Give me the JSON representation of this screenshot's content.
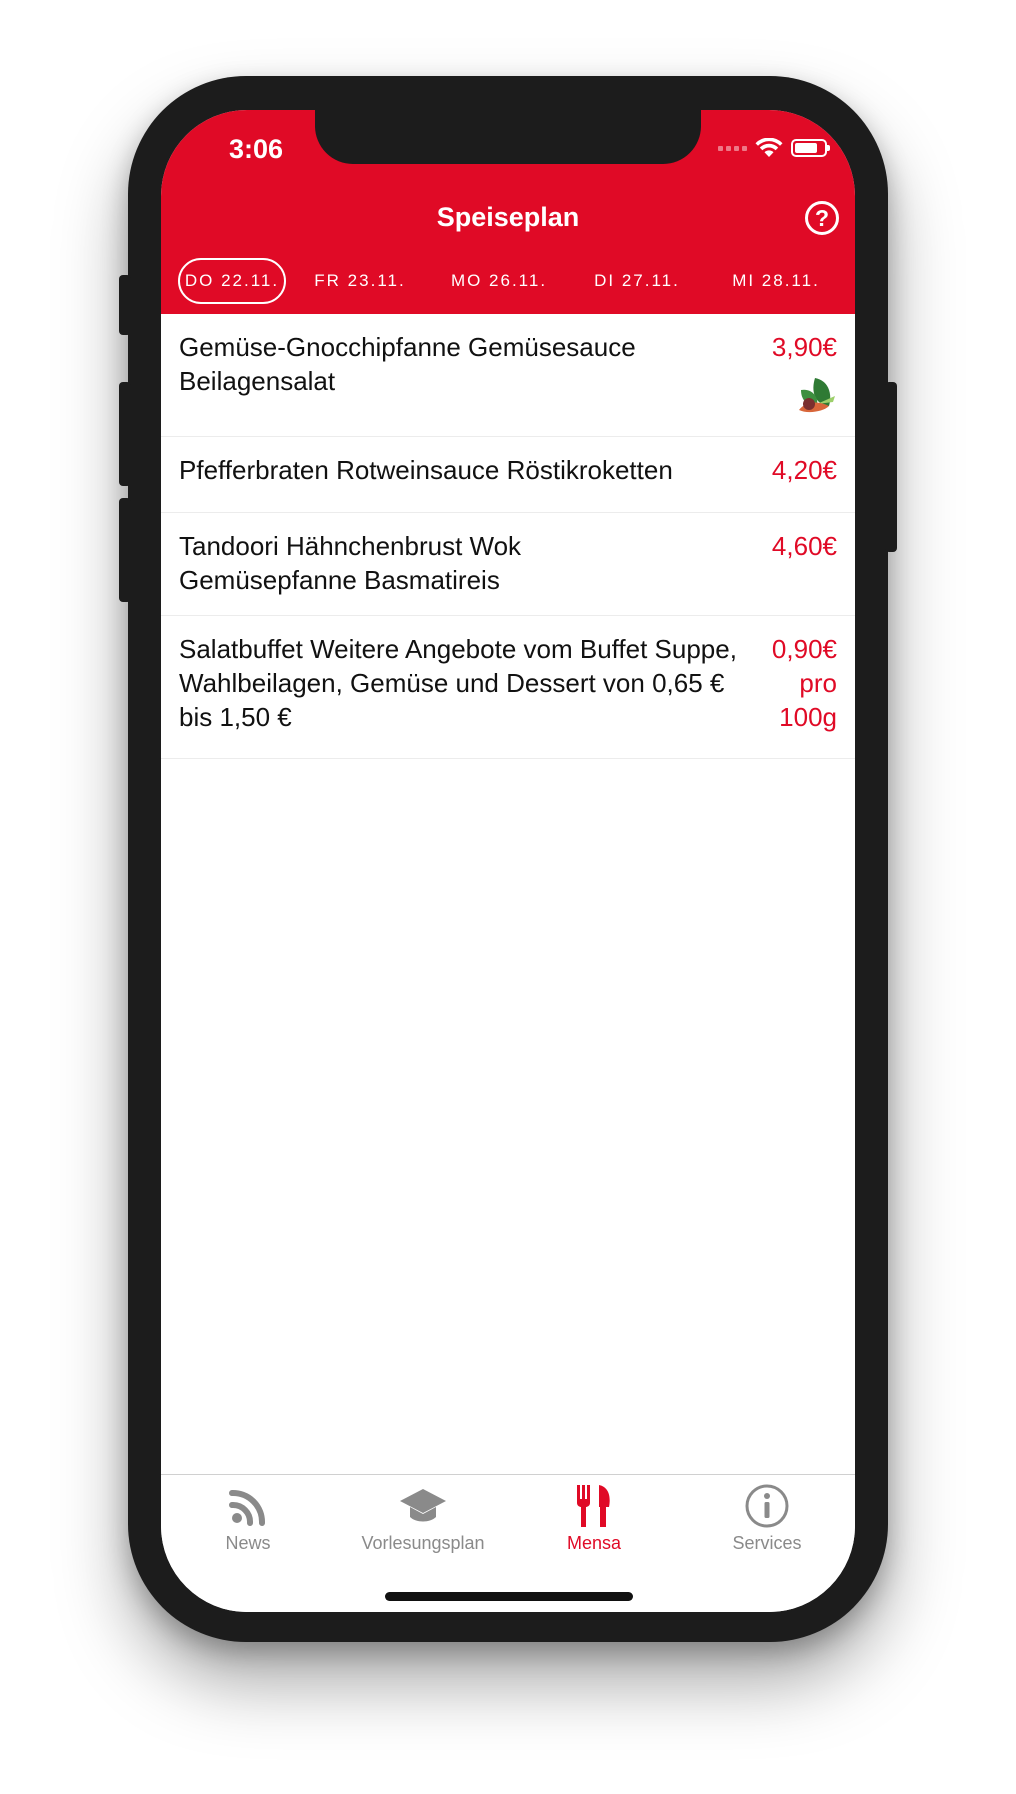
{
  "status_bar": {
    "time": "3:06"
  },
  "nav": {
    "title": "Speiseplan",
    "help_icon": "question-circle-icon"
  },
  "date_tabs": [
    {
      "label": "DO 22.11.",
      "active": true
    },
    {
      "label": "FR 23.11.",
      "active": false
    },
    {
      "label": "MO 26.11.",
      "active": false
    },
    {
      "label": "DI 27.11.",
      "active": false
    },
    {
      "label": "MI 28.11.",
      "active": false
    }
  ],
  "menu": [
    {
      "name": "Gemüse-Gnocchipfanne Gemüsesauce Beilagensalat",
      "price": "3,90€",
      "vegetarian": true
    },
    {
      "name": "Pfefferbraten Rotweinsauce Röstikroketten",
      "price": "4,20€",
      "vegetarian": false
    },
    {
      "name": "Tandoori Hähnchenbrust Wok Gemüsepfanne Basmatireis",
      "price": "4,60€",
      "vegetarian": false
    },
    {
      "name": "Salatbuffet Weitere Angebote vom Buffet Suppe, Wahlbeilagen, Gemüse und Dessert von 0,65 € bis 1,50 €",
      "price": "0,90€ pro 100g",
      "vegetarian": false
    }
  ],
  "tabbar": {
    "items": [
      {
        "label": "News",
        "icon": "rss-icon",
        "active": false
      },
      {
        "label": "Vorlesungsplan",
        "icon": "graduation-cap-icon",
        "active": false
      },
      {
        "label": "Mensa",
        "icon": "fork-knife-icon",
        "active": true
      },
      {
        "label": "Services",
        "icon": "info-circle-icon",
        "active": false
      }
    ]
  },
  "colors": {
    "accent": "#e00a26",
    "inactive": "#8a8a8a",
    "bezel": "#1c1c1c"
  },
  "battery_level": 0.8
}
